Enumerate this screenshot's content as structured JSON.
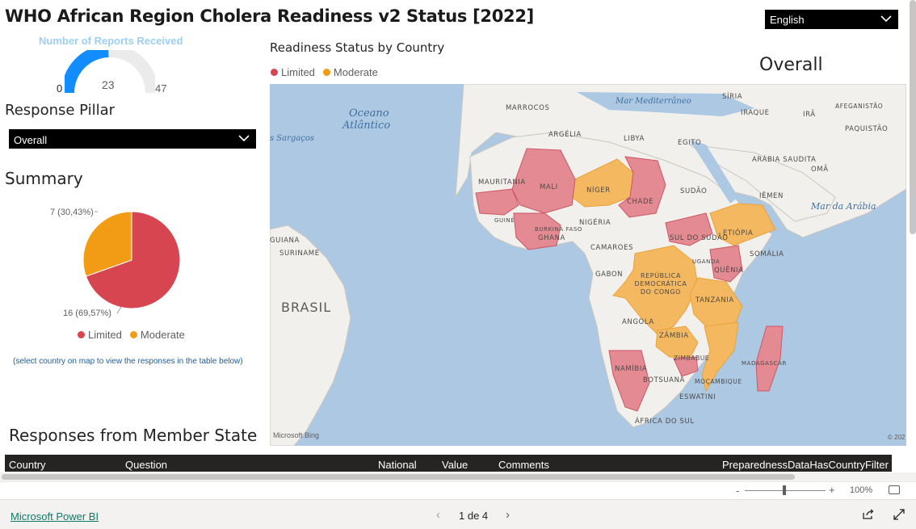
{
  "report": {
    "title": "WHO African Region Cholera Readiness v2 Status [2022]",
    "language": "English"
  },
  "gauge": {
    "title": "Number of Reports Received",
    "min": "0",
    "value": "23",
    "max": "47",
    "color": "#118dff"
  },
  "pillar": {
    "heading": "Response Pillar",
    "selected": "Overall"
  },
  "summary": {
    "heading": "Summary",
    "label_moderate": "7 (30,43%)",
    "label_limited": "16 (69,57%)",
    "hint": "(select country on map to view the responses in the table below)"
  },
  "chart_data": {
    "type": "pie",
    "categories": [
      "Limited",
      "Moderate"
    ],
    "values": [
      16,
      7
    ],
    "colors": [
      "#d64550",
      "#f29b14"
    ],
    "legend": "bottom"
  },
  "legend": {
    "limited": "Limited",
    "moderate": "Moderate",
    "limited_color": "#d64550",
    "moderate_color": "#f29b14"
  },
  "map": {
    "heading": "Readiness Status by Country",
    "overall": "Overall",
    "ocean_labels": [
      "Oceano",
      "Atlântico",
      "Mar Mediterrâneo",
      "Mar da Arábia",
      "s Sargaços"
    ],
    "country_labels": [
      "MARROCOS",
      "ARGÉLIA",
      "LIBYA",
      "EGITO",
      "MAURITANIA",
      "MALI",
      "NÍGER",
      "CHADE",
      "SUDÃO",
      "BURKINA FASO",
      "GUINÉ",
      "GHANA",
      "NIGÉRIA",
      "CAMAROES",
      "SUL DO SUDÃO",
      "ETIÓPIA",
      "SOMÁLIA",
      "UGANDA",
      "QUÊNIA",
      "GABON",
      "REPÚBLICA DEMOCRÁTICA DO CONGO",
      "TANZANIA",
      "ANGOLA",
      "ZÂMBIA",
      "ZIMBABUE",
      "NAMÍBIA",
      "BOTSUANA",
      "MOÇAMBIQUE",
      "MADAGASCAR",
      "ESWATINI",
      "ÁFRICA DO SUL",
      "SÍRIA",
      "IRAQUE",
      "IRÃ",
      "AFEGANISTÃO",
      "PAQUISTÃO",
      "ARÁBIA SAUDITA",
      "OMÃ",
      "IÊMEN",
      "BRASIL",
      "SURINAME",
      "GUIANA"
    ],
    "attribution": "Microsoft Bing",
    "copyright": "© 202"
  },
  "responses": {
    "heading": "Responses from Member State",
    "columns": [
      "Country",
      "Question",
      "National",
      "Value",
      "Comments",
      "PreparednessDataHasCountryFilter"
    ]
  },
  "zoom": {
    "minus": "-",
    "plus": "+",
    "level": "100%"
  },
  "footer": {
    "brand": "Microsoft Power BI",
    "pager": "1 de 4",
    "prev": "‹",
    "next": "›"
  }
}
